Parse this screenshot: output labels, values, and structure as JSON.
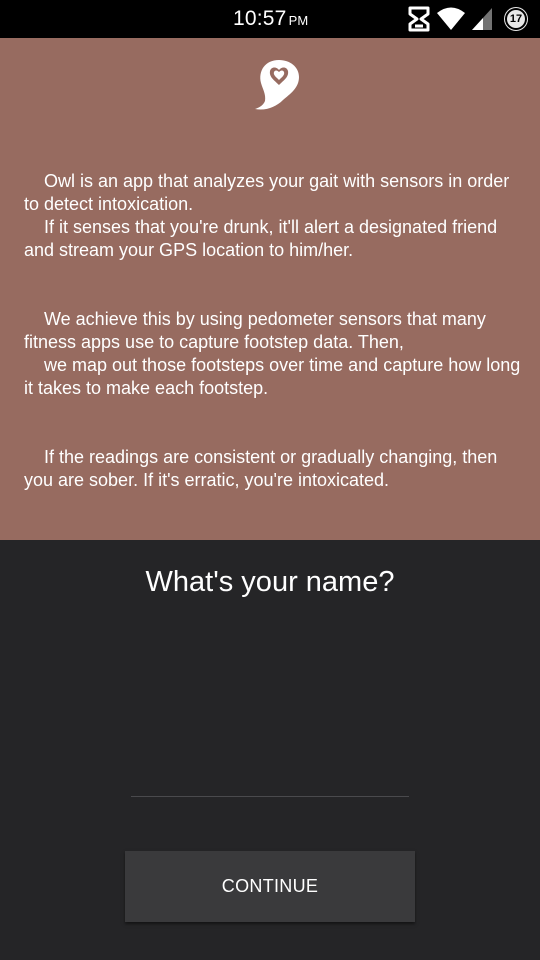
{
  "status_bar": {
    "time": "10:57",
    "ampm": "PM",
    "notification_count": "17",
    "icons": [
      "data-sync-icon",
      "wifi-icon",
      "cell-signal-icon",
      "notification-badge"
    ]
  },
  "info": {
    "logo_icon": "owl-heart-logo-icon",
    "paragraphs": [
      {
        "line1": "Owl is an app that analyzes your gait with sensors in order to detect intoxication.",
        "line2": "If it senses that you're drunk, it'll alert a designated friend and stream your GPS location to him/her."
      },
      {
        "line1": "We achieve this by using pedometer sensors that many fitness apps use to capture footstep data. Then,",
        "line2": "we  map out those footsteps over time and capture how long it takes to make each footstep."
      },
      {
        "line1": "If the readings are consistent or gradually changing, then you are sober. If it's erratic, you're intoxicated."
      }
    ]
  },
  "form": {
    "question": "What's your name?",
    "name_value": "",
    "name_placeholder": "",
    "continue_label": "CONTINUE"
  },
  "colors": {
    "info_background": "#976b60",
    "form_background": "#252527",
    "button_background": "#3a3a3c"
  }
}
